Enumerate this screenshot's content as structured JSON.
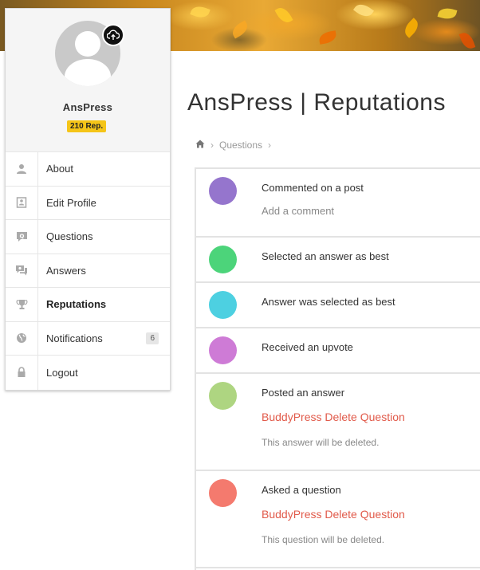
{
  "profile": {
    "name": "AnsPress",
    "reputation_badge": "210 Rep."
  },
  "menu": {
    "items": [
      {
        "label": "About",
        "icon": "user-icon"
      },
      {
        "label": "Edit Profile",
        "icon": "profile-card-icon"
      },
      {
        "label": "Questions",
        "icon": "question-bubble-icon"
      },
      {
        "label": "Answers",
        "icon": "answers-bubble-icon"
      },
      {
        "label": "Reputations",
        "icon": "trophy-icon",
        "active": true
      },
      {
        "label": "Notifications",
        "icon": "globe-icon",
        "count": "6"
      },
      {
        "label": "Logout",
        "icon": "lock-icon"
      }
    ]
  },
  "page": {
    "title": "AnsPress | Reputations"
  },
  "breadcrumb": {
    "items": [
      "Questions"
    ]
  },
  "activities": [
    {
      "heading": "Commented on a post",
      "sub": "Add a comment",
      "color": "#9575cd"
    },
    {
      "heading": "Selected an answer as best",
      "color": "#4cd47a"
    },
    {
      "heading": "Answer was selected as best",
      "color": "#4dd0e1"
    },
    {
      "heading": "Received an upvote",
      "color": "#ce7bd6"
    },
    {
      "heading": "Posted an answer",
      "link": "BuddyPress Delete Question",
      "note": "This answer will be deleted.",
      "color": "#aed581"
    },
    {
      "heading": "Asked a question",
      "link": "BuddyPress Delete Question",
      "note": "This question will be deleted.",
      "color": "#f47a6e"
    }
  ],
  "colors": {
    "accent_link": "#e15a4a",
    "badge": "#f5c518"
  }
}
